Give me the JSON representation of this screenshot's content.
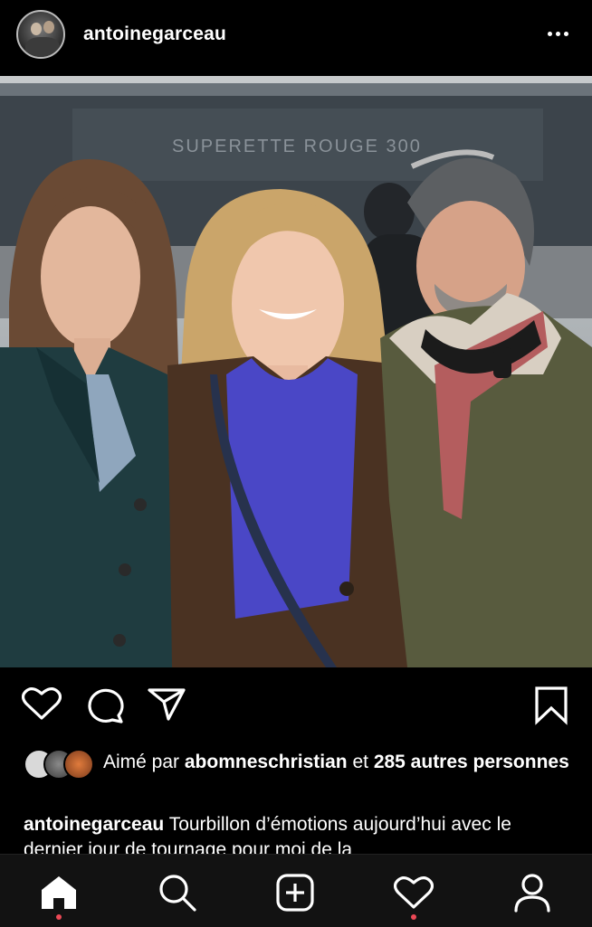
{
  "post": {
    "username": "antoinegarceau",
    "likes_prefix": "Aimé par",
    "likes_user": "abomneschristian",
    "likes_connector": "et",
    "likes_count_text": "285 autres personnes",
    "caption_user": "antoinegarceau",
    "caption_text": "Tourbillon d’émotions aujourd’hui avec le dernier  jour de tournage pour moi de la"
  },
  "photo": {
    "background_sign": "SUPERETTE ROUGE 300"
  },
  "icons": {
    "header": [
      "avatar",
      "more-options-icon"
    ],
    "actions": [
      "heart-icon",
      "comment-icon",
      "share-icon",
      "bookmark-icon"
    ],
    "nav": [
      "home-icon",
      "search-icon",
      "new-post-icon",
      "activity-heart-icon",
      "profile-icon"
    ]
  },
  "colors": {
    "background": "#000000",
    "text": "#ffffff",
    "nav_background": "#121212",
    "notification_dot": "#ed4956"
  }
}
